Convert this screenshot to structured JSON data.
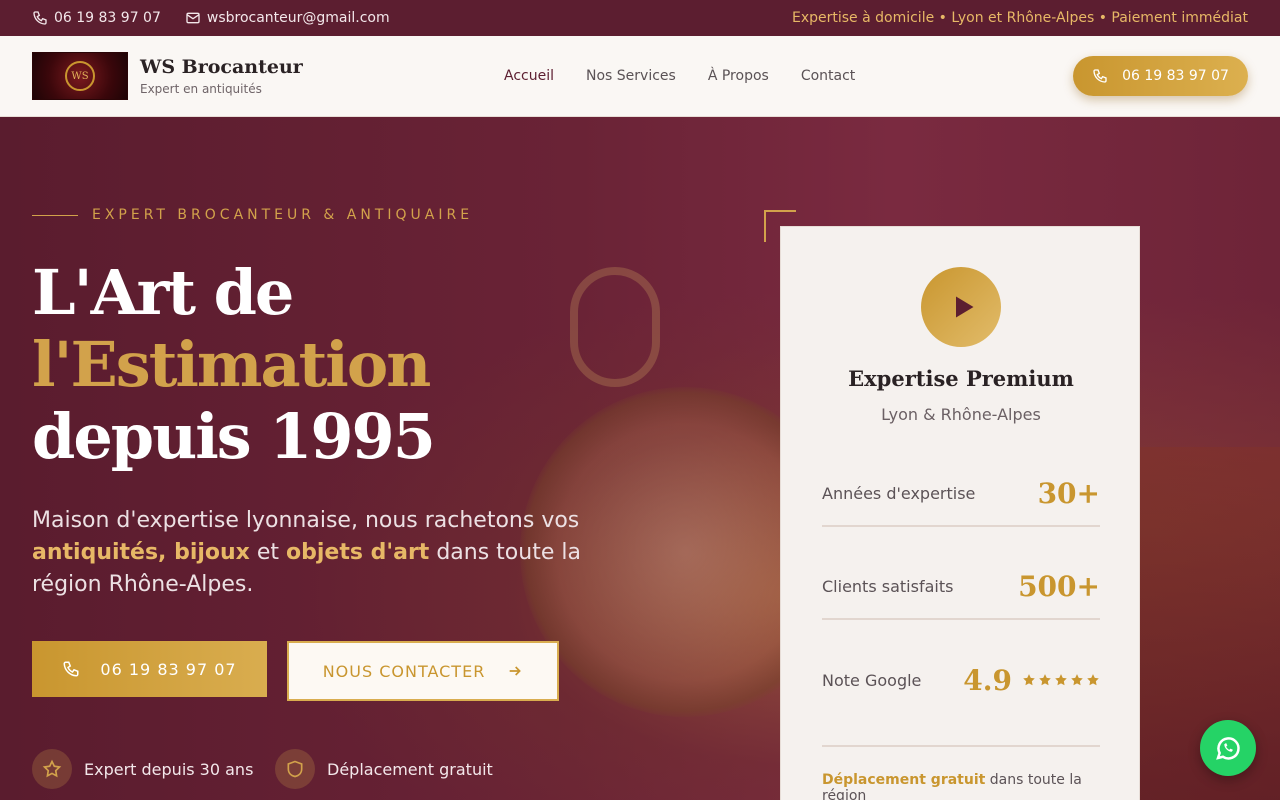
{
  "topbar": {
    "phone": "06 19 83 97 07",
    "email": "wsbrocanteur@gmail.com",
    "promo": "Expertise à domicile • Lyon et Rhône-Alpes • Paiement immédiat"
  },
  "nav": {
    "logo_initials": "WS",
    "brand_name": "WS Brocanteur",
    "brand_tagline": "Expert en antiquités",
    "menu": [
      "Accueil",
      "Nos Services",
      "À Propos",
      "Contact"
    ],
    "active_item": "Accueil",
    "cta_phone": "06 19 83 97 07"
  },
  "hero": {
    "eyebrow": "EXPERT BROCANTEUR & ANTIQUAIRE",
    "title_line1": "L'Art de",
    "title_line2": "l'Estimation",
    "title_line3": "depuis 1995",
    "lead_part1": "Maison d'expertise lyonnaise, nous rachetons vos ",
    "lead_hl1": "antiquités, bijoux",
    "lead_part2": " et ",
    "lead_hl2": "objets d'art",
    "lead_part3": " dans toute la région Rhône-Alpes.",
    "btn_call": "06 19 83 97 07",
    "btn_contact": "NOUS CONTACTER",
    "features": [
      "Expert depuis 30 ans",
      "Déplacement gratuit"
    ]
  },
  "card": {
    "title": "Expertise Premium",
    "subtitle": "Lyon & Rhône-Alpes",
    "stats": [
      {
        "label": "Années d'expertise",
        "value": "30+"
      },
      {
        "label": "Clients satisfaits",
        "value": "500+"
      },
      {
        "label": "Note Google",
        "value": "4.9"
      }
    ],
    "stars": 5,
    "note_hl": "Déplacement gratuit",
    "note_rest": " dans toute la région"
  },
  "colors": {
    "burgundy": "#5c1e30",
    "gold": "#c9962f",
    "whatsapp": "#25d366"
  },
  "icons": [
    "phone-icon",
    "mail-icon",
    "play-icon",
    "arrow-right-icon",
    "star-icon",
    "shield-icon",
    "whatsapp-icon"
  ]
}
